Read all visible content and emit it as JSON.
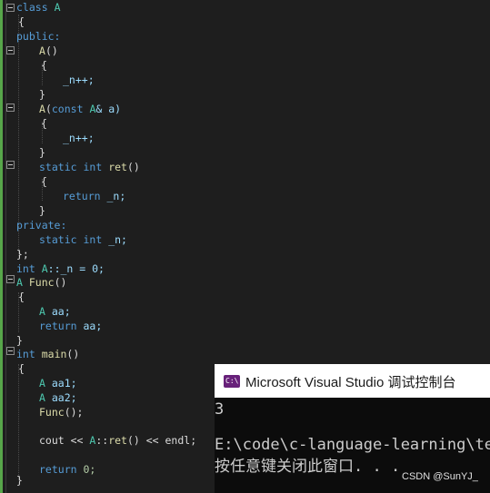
{
  "editor": {
    "lines": {
      "l1_kw": "class",
      "l1_name": "A",
      "l2": "{",
      "l3": "public:",
      "l4_fn": "A",
      "l4_rest": "()",
      "l5": "{",
      "l6": "_n++;",
      "l7": "}",
      "l8_fn": "A",
      "l8_open": "(",
      "l8_kw": "const",
      "l8_ty": "A",
      "l8_rest": "& a)",
      "l9": "{",
      "l10": "_n++;",
      "l11": "}",
      "l12_kw1": "static",
      "l12_kw2": "int",
      "l12_fn": "ret",
      "l12_rest": "()",
      "l13": "{",
      "l14_kw": "return",
      "l14_rest": "_n;",
      "l15": "}",
      "l16": "private:",
      "l17_kw1": "static",
      "l17_kw2": "int",
      "l17_rest": "_n;",
      "l18": "};",
      "l19_kw": "int",
      "l19_ty": "A",
      "l19_rest": "::_n = 0;",
      "l20_ty": "A",
      "l20_fn": "Func",
      "l20_rest": "()",
      "l21": "{",
      "l22_ty": "A",
      "l22_rest": "aa;",
      "l23_kw": "return",
      "l23_rest": "aa;",
      "l24": "}",
      "l25_kw": "int",
      "l25_fn": "main",
      "l25_rest": "()",
      "l26": "{",
      "l27_ty": "A",
      "l27_rest": "aa1;",
      "l28_ty": "A",
      "l28_rest": "aa2;",
      "l29_fn": "Func",
      "l29_rest": "();",
      "l30_a": "cout << ",
      "l30_ty": "A",
      "l30_b": "::",
      "l30_fn": "ret",
      "l30_c": "() << endl;",
      "l31_kw": "return",
      "l31_rest": "0;",
      "l32": "}"
    }
  },
  "console": {
    "title": "Microsoft Visual Studio 调试控制台",
    "icon_text": "C:\\",
    "output": "3",
    "path": "E:\\code\\c-language-learning\\tes",
    "prompt": "按任意键关闭此窗口. . ."
  },
  "watermark": "CSDN @SunYJ_",
  "colors": {
    "keyword": "#569cd6",
    "type": "#4ec9b0",
    "function": "#dcdcaa",
    "variable": "#9cdcfe",
    "number": "#b5cea8",
    "accent": "#68217a"
  }
}
